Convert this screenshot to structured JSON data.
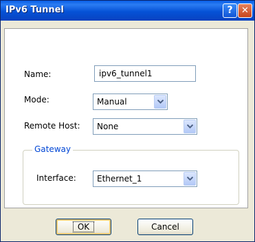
{
  "window": {
    "title": "IPv6 Tunnel",
    "help_label": "?",
    "close_label": "✕"
  },
  "form": {
    "name_label": "Name:",
    "name_value": "ipv6_tunnel1",
    "mode_label": "Mode:",
    "mode_value": "Manual",
    "remote_host_label": "Remote Host:",
    "remote_host_value": "None",
    "gateway_title": "Gateway",
    "interface_label": "Interface:",
    "interface_value": "Ethernet_1"
  },
  "buttons": {
    "ok": "OK",
    "cancel": "Cancel"
  },
  "colors": {
    "titlebar": "#0a5fe8",
    "group_title": "#0046d5",
    "dialog_bg": "#ece9d8"
  }
}
